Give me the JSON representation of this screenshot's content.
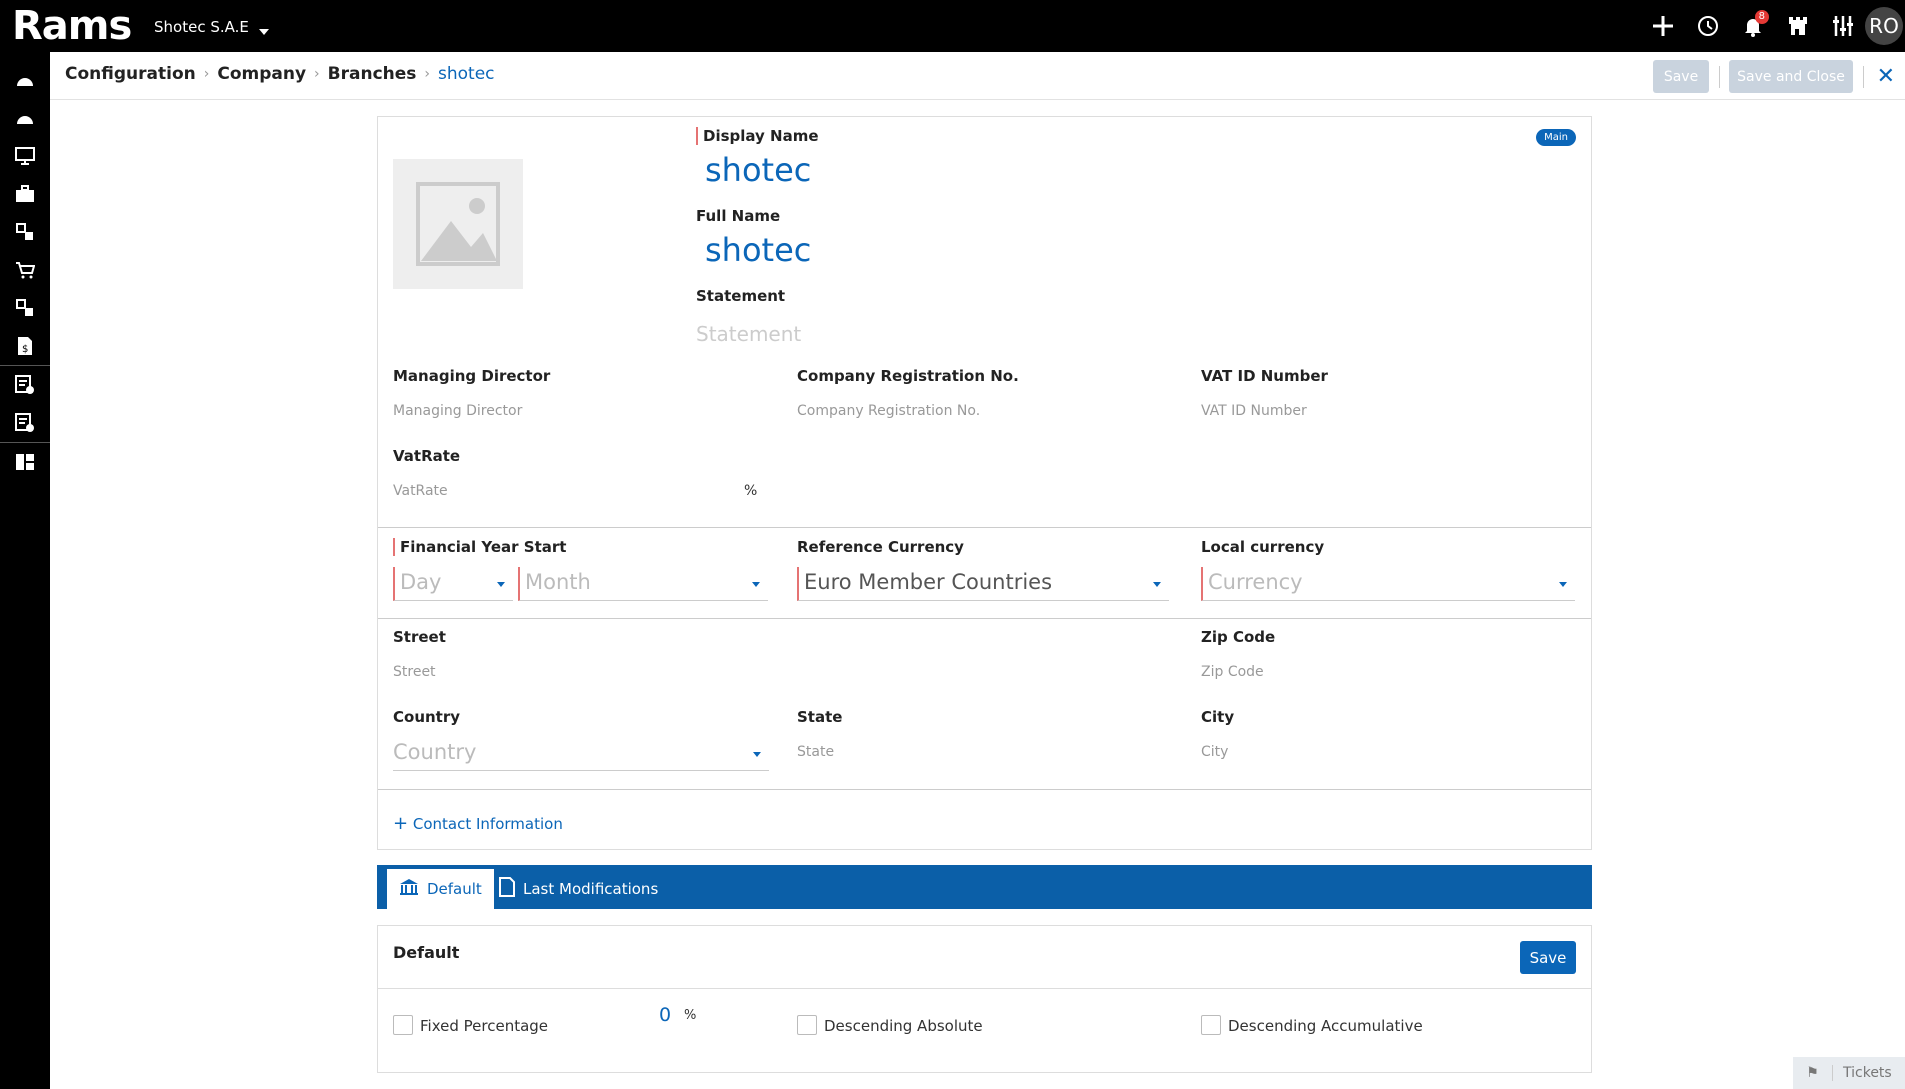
{
  "app": {
    "logo": "Rams",
    "company": "Shotec S.A.E",
    "avatar_initials": "RO",
    "notification_count": "8"
  },
  "topbar": {
    "icons": [
      "plus-icon",
      "history-icon",
      "bell-icon",
      "castle-icon",
      "sliders-icon"
    ]
  },
  "sidebar": {
    "icons": [
      "dashboard-icon",
      "dashboard-alt-icon",
      "monitor-icon",
      "briefcase-icon",
      "modules-icon",
      "cart-icon",
      "modules-alt-icon",
      "invoice-dollar-icon",
      "report-check-icon",
      "report-settings-icon",
      "grid-settings-icon"
    ]
  },
  "breadcrumb": {
    "items": [
      "Configuration",
      "Company",
      "Branches"
    ],
    "current": "shotec"
  },
  "toolbar": {
    "save": "Save",
    "save_close": "Save and Close"
  },
  "form": {
    "main_badge": "Main",
    "display_name_label": "Display Name",
    "display_name": "shotec",
    "full_name_label": "Full Name",
    "full_name": "shotec",
    "statement_label": "Statement",
    "statement_placeholder": "Statement",
    "managing_director_label": "Managing Director",
    "managing_director_placeholder": "Managing Director",
    "company_reg_label": "Company Registration No.",
    "company_reg_placeholder": "Company Registration No.",
    "vat_id_label": "VAT ID Number",
    "vat_id_placeholder": "VAT ID Number",
    "vatrate_label": "VatRate",
    "vatrate_placeholder": "VatRate",
    "vatrate_unit": "%",
    "fin_year_label": "Financial Year Start",
    "day_placeholder": "Day",
    "month_placeholder": "Month",
    "ref_currency_label": "Reference Currency",
    "ref_currency_value": "Euro Member Countries",
    "local_currency_label": "Local currency",
    "local_currency_placeholder": "Currency",
    "street_label": "Street",
    "street_placeholder": "Street",
    "zip_label": "Zip Code",
    "zip_placeholder": "Zip Code",
    "country_label": "Country",
    "country_placeholder": "Country",
    "state_label": "State",
    "state_placeholder": "State",
    "city_label": "City",
    "city_placeholder": "City",
    "contact_link": "Contact Information"
  },
  "tabs": [
    {
      "label": "Default"
    },
    {
      "label": "Last Modifications"
    }
  ],
  "panel": {
    "title": "Default",
    "save": "Save",
    "fixed_percentage": "Fixed Percentage",
    "fixed_value": "0",
    "fixed_unit": "%",
    "descending_absolute": "Descending Absolute",
    "descending_accumulative": "Descending Accumulative"
  },
  "tickets": "Tickets"
}
